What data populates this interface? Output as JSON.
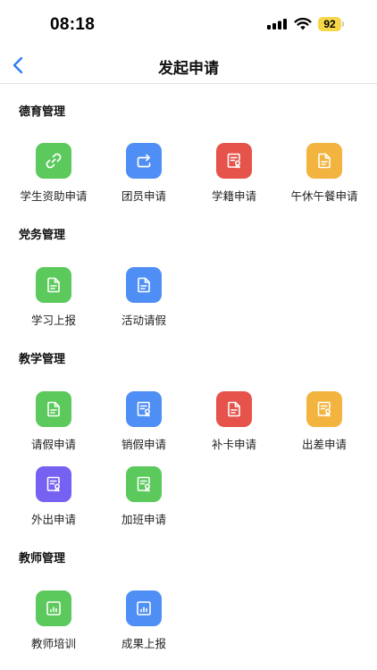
{
  "status_bar": {
    "time": "08:18",
    "battery": "92"
  },
  "nav": {
    "title": "发起申请"
  },
  "sections": {
    "moral": {
      "title": "德育管理",
      "items": [
        {
          "label": "学生资助申请",
          "icon": "link-icon",
          "color": "#5bc95b"
        },
        {
          "label": "团员申请",
          "icon": "share-arrow-icon",
          "color": "#4f8ff5"
        },
        {
          "label": "学籍申请",
          "icon": "certificate-icon",
          "color": "#e5534b"
        },
        {
          "label": "午休午餐申请",
          "icon": "document-icon",
          "color": "#f3b43f"
        }
      ]
    },
    "party": {
      "title": "党务管理",
      "items": [
        {
          "label": "学习上报",
          "icon": "document-icon",
          "color": "#5bc95b"
        },
        {
          "label": "活动请假",
          "icon": "document-icon",
          "color": "#4f8ff5"
        }
      ]
    },
    "teaching": {
      "title": "教学管理",
      "items": [
        {
          "label": "请假申请",
          "icon": "document-icon",
          "color": "#5bc95b"
        },
        {
          "label": "销假申请",
          "icon": "certificate-icon",
          "color": "#4f8ff5"
        },
        {
          "label": "补卡申请",
          "icon": "document-icon",
          "color": "#e5534b"
        },
        {
          "label": "出差申请",
          "icon": "certificate-icon",
          "color": "#f3b43f"
        },
        {
          "label": "外出申请",
          "icon": "certificate-icon",
          "color": "#7561f2"
        },
        {
          "label": "加班申请",
          "icon": "certificate-icon",
          "color": "#5bc95b"
        }
      ]
    },
    "teacher": {
      "title": "教师管理",
      "items": [
        {
          "label": "教师培训",
          "icon": "chart-icon",
          "color": "#5bc95b"
        },
        {
          "label": "成果上报",
          "icon": "chart-icon",
          "color": "#4f8ff5"
        }
      ]
    }
  }
}
